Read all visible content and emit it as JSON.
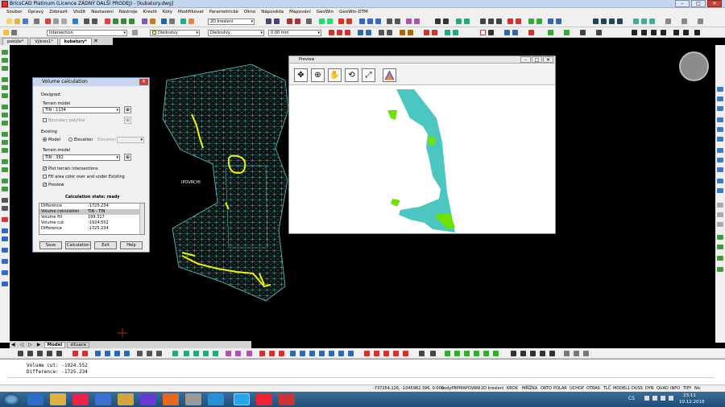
{
  "app": {
    "title": "BricsCAD Platinum (Licence ZÁDNÝ DALŠÍ PRODEJ) - [kubatury.dwg]"
  },
  "menu": [
    "Soubor",
    "Úpravy",
    "Zobrazit",
    "Vložit",
    "Nastavení",
    "Nástroje",
    "Kreslit",
    "Kóty",
    "Modifikovat",
    "Parametrické",
    "Okno",
    "Nápověda",
    "Mapování",
    "GeoWin",
    "GeoWin-DTM"
  ],
  "toolbar": {
    "layer_combo": "Intersection",
    "color_combo": "Dlelinstvy",
    "linetype_combo": "Dlelinstvy",
    "lineweight_combo": "0.00 mm",
    "view_combo": "2D kreslení"
  },
  "doc_tabs": [
    "pokóže*",
    "Výkres1*",
    "kubatury*"
  ],
  "drawing": {
    "label": "IPOVRCHI"
  },
  "dialog": {
    "title": "Volume calculation",
    "designed_label": "Designed",
    "terrain_model_label": "Terrain model",
    "designed_model": "TIN : 1134",
    "boundary_polyline": "Boundary polyline",
    "existing_label": "Existing",
    "model_radio": "Model",
    "elevation_radio": "Elevation",
    "elevation_field": "Elevation",
    "existing_model": "TIN : 391",
    "plot_intersections": "Plot terrain intersections",
    "fill_area": "Fill area color over and under Existing",
    "preview": "Preview",
    "calc_state": "Calculation state: ready",
    "rows": [
      {
        "k": "Difference",
        "v": "-1725.234"
      },
      {
        "k": "Volume calculation",
        "v": "TIN - TIN"
      },
      {
        "k": "Volume fill",
        "v": "199.317"
      },
      {
        "k": "Volume cut",
        "v": "-1924.552"
      },
      {
        "k": "Difference",
        "v": "-1725.234"
      }
    ],
    "buttons": {
      "save": "Save",
      "calculation": "Calculation",
      "exit": "Exit",
      "help": "Help"
    }
  },
  "preview_window": {
    "title": "Preview"
  },
  "layout_tabs": [
    "Model",
    "situace"
  ],
  "command_line": {
    "line1": "Volume cut: -1924.552",
    "line2": "Difference: -1725.234"
  },
  "status": {
    "coords": "-737254.126, -1045982.396, 0.000",
    "items": [
      "bodyPBP",
      "MAPOVANI",
      "2D kreslení",
      "KROK",
      "MŘÍŽKA",
      "ORTO",
      "POLAR",
      "UCHOP",
      "OTRAS",
      "TLČ",
      "MODEL1",
      "DUSS",
      "DYN",
      "QUAD",
      "INFO",
      "TIPY",
      "Nic"
    ]
  },
  "taskbar": {
    "lang": "CS",
    "time": "23:11",
    "date": "10.12.2018"
  },
  "colors": {
    "cut": "#4cc6c0",
    "fill": "#6ee300",
    "mesh": "#5ec8c2",
    "highlight": "#f3f300"
  }
}
